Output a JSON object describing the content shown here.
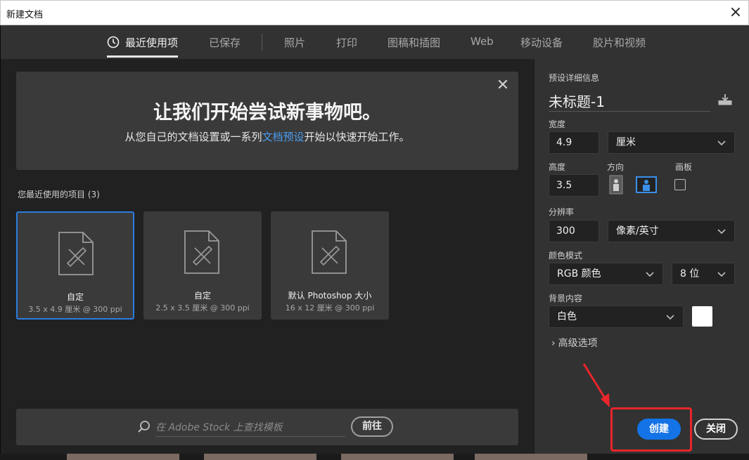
{
  "window": {
    "title": "新建文档"
  },
  "tabs": [
    {
      "label": "最近使用项"
    },
    {
      "label": "已保存"
    },
    {
      "label": "照片"
    },
    {
      "label": "打印"
    },
    {
      "label": "图稿和插图"
    },
    {
      "label": "Web"
    },
    {
      "label": "移动设备"
    },
    {
      "label": "胶片和视频"
    }
  ],
  "welcome": {
    "title": "让我们开始尝试新事物吧。",
    "subtitle_pre": "从您自己的文档设置或一系列",
    "subtitle_link": "文档预设",
    "subtitle_post": "开始以快速开始工作。"
  },
  "recent": {
    "label": "您最近使用的项目 (3)",
    "items": [
      {
        "name": "自定",
        "size": "3.5 x 4.9 厘米 @ 300 ppi"
      },
      {
        "name": "自定",
        "size": "2.5 x 3.5 厘米 @ 300 ppi"
      },
      {
        "name": "默认 Photoshop 大小",
        "size": "16 x 12 厘米 @ 300 ppi"
      }
    ]
  },
  "search": {
    "placeholder": "在 Adobe Stock 上查找模板",
    "go_label": "前往"
  },
  "preset": {
    "header": "预设详细信息",
    "doc_name": "未标题-1",
    "width_label": "宽度",
    "width_value": "4.9",
    "width_unit": "厘米",
    "height_label": "高度",
    "height_value": "3.5",
    "orientation_label": "方向",
    "artboard_label": "画板",
    "resolution_label": "分辨率",
    "resolution_value": "300",
    "resolution_unit": "像素/英寸",
    "color_mode_label": "颜色模式",
    "color_mode": "RGB 颜色",
    "bit_depth": "8 位",
    "background_label": "背景内容",
    "background_value": "白色",
    "advanced_label": "高级选项"
  },
  "actions": {
    "create_label": "创建",
    "close_label": "关闭"
  },
  "colors": {
    "accent": "#1473e6",
    "annotation": "#e8262b",
    "link": "#4a9cf0"
  }
}
